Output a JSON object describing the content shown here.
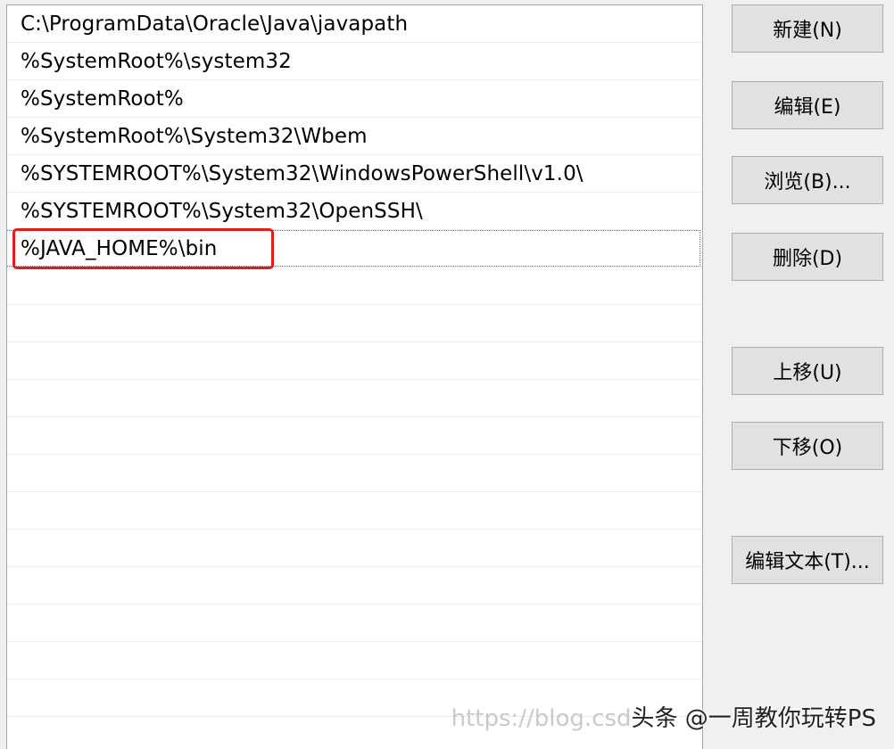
{
  "path_entries": [
    "C:\\ProgramData\\Oracle\\Java\\javapath",
    "%SystemRoot%\\system32",
    "%SystemRoot%",
    "%SystemRoot%\\System32\\Wbem",
    "%SYSTEMROOT%\\System32\\WindowsPowerShell\\v1.0\\",
    "%SYSTEMROOT%\\System32\\OpenSSH\\",
    "%JAVA_HOME%\\bin"
  ],
  "buttons": {
    "new": "新建(N)",
    "edit": "编辑(E)",
    "browse": "浏览(B)...",
    "delete": "删除(D)",
    "move_up": "上移(U)",
    "move_down": "下移(O)",
    "edit_text": "编辑文本(T)..."
  },
  "watermark": {
    "url": "https://blog.csd",
    "author": "头条 @一周教你玩转PS"
  },
  "colors": {
    "highlight": "#e21b1b",
    "list_bg": "#ffffff",
    "window_bg": "#f0f0f0",
    "button_bg": "#e1e1e1"
  }
}
